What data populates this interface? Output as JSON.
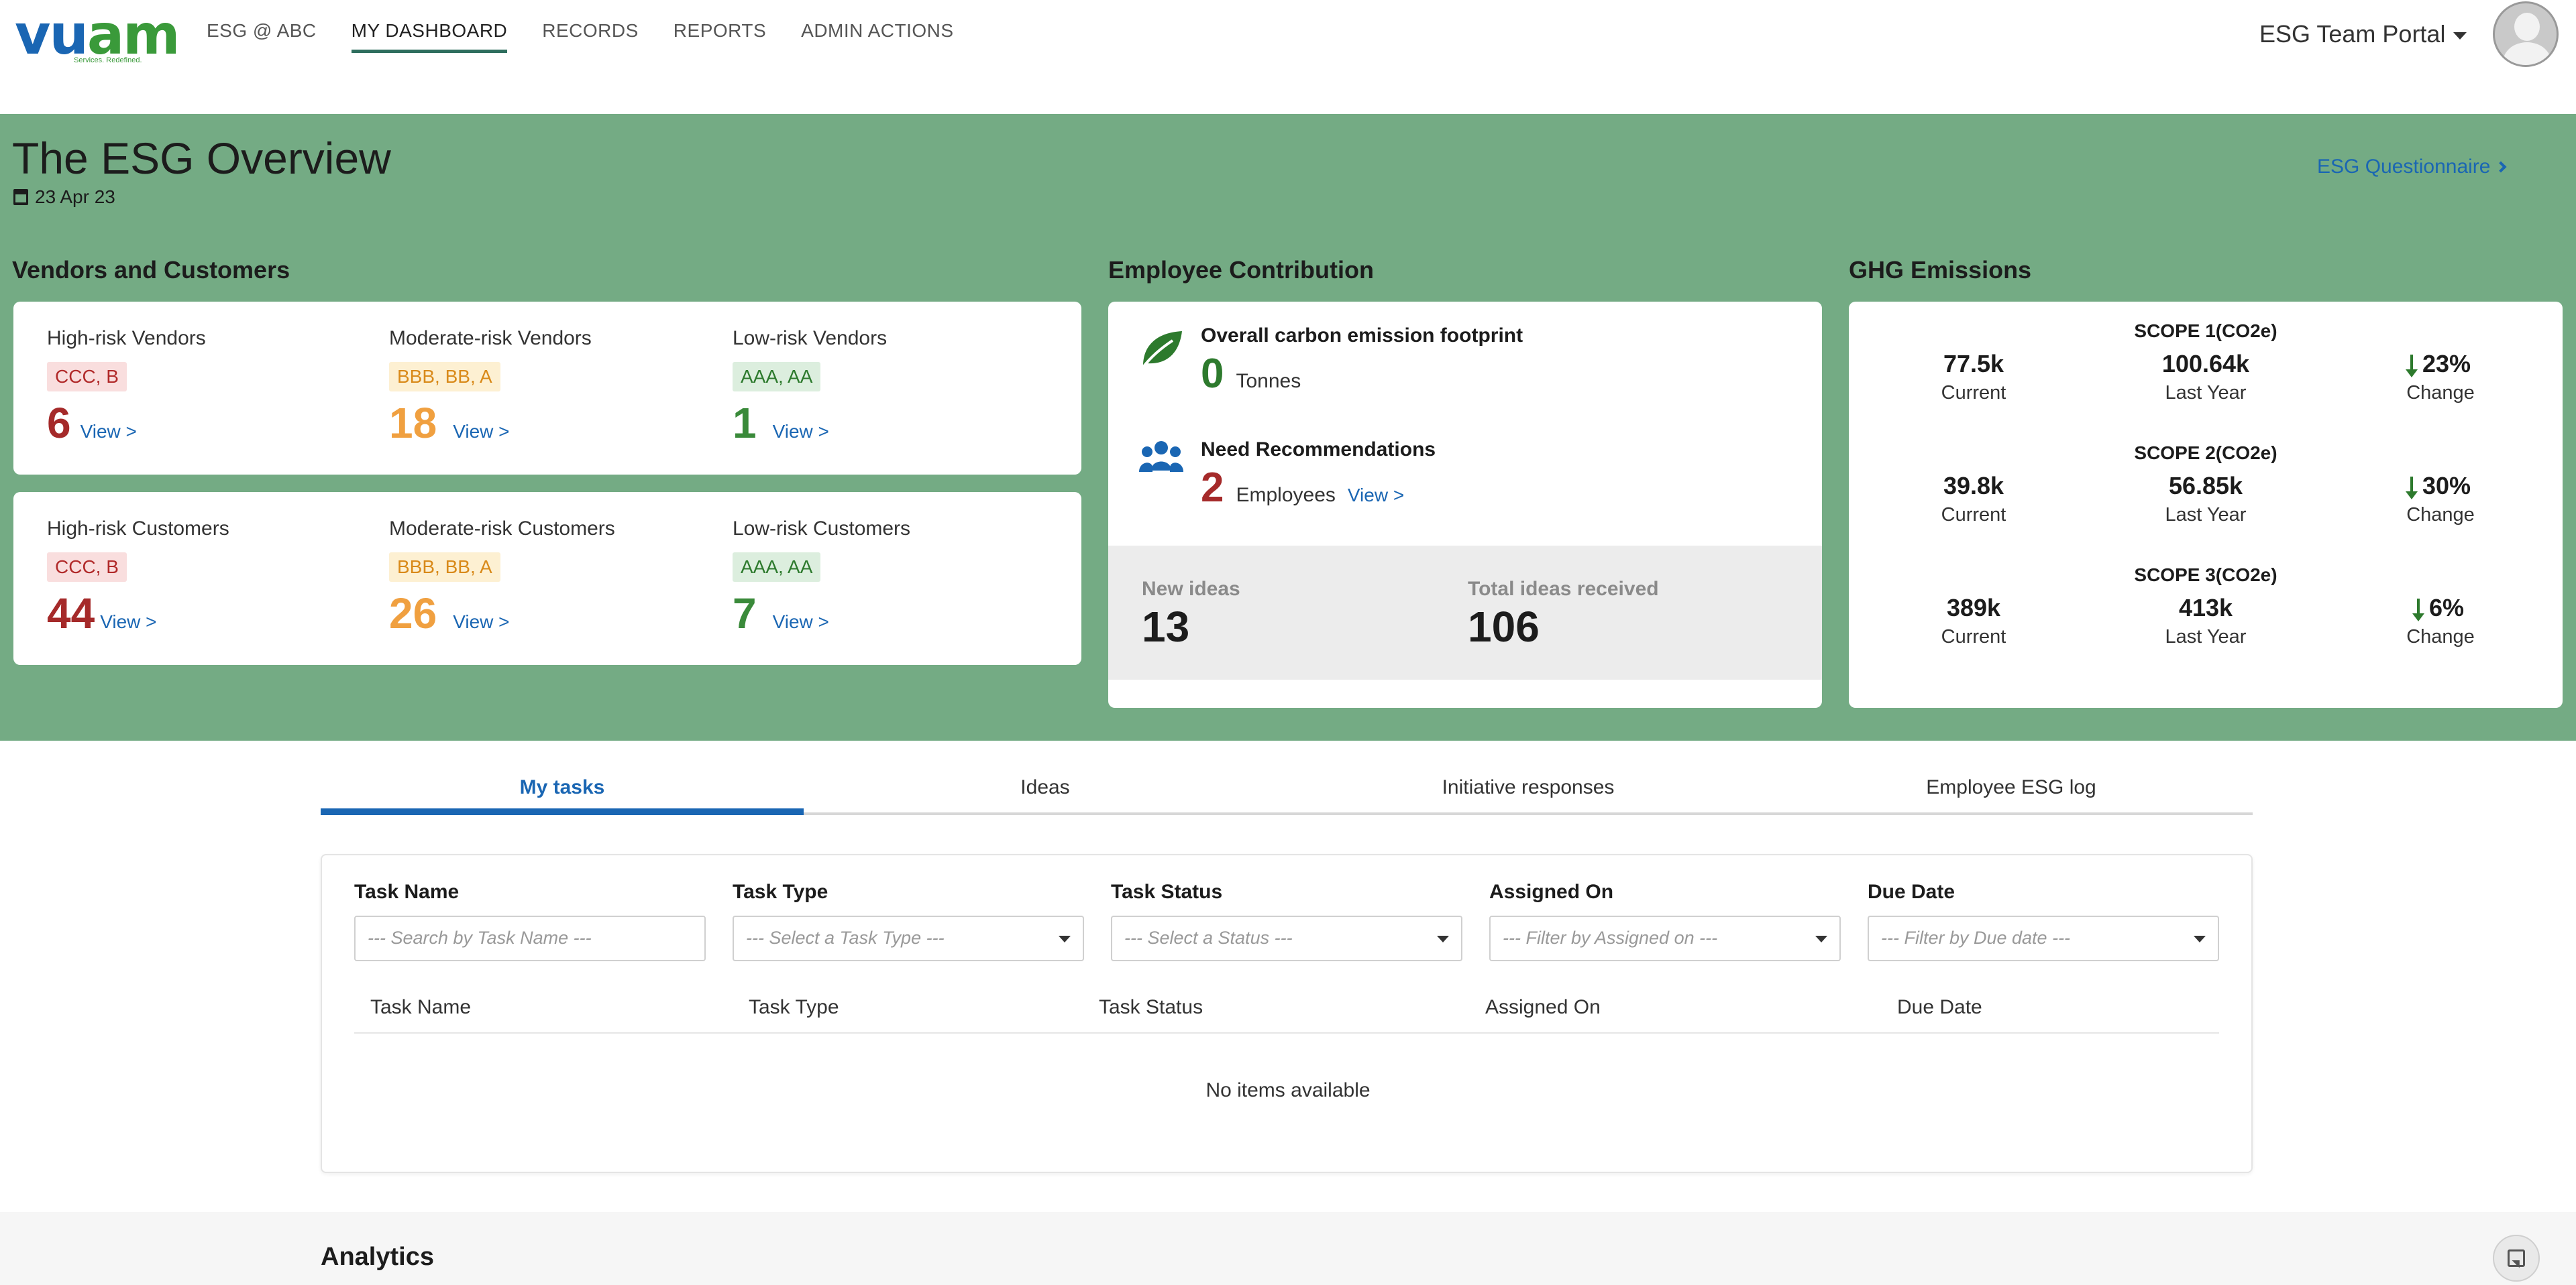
{
  "brand": {
    "logo_main": "vu",
    "logo_accent": "am",
    "logo_tagline": "Services. Redefined."
  },
  "nav": {
    "items": [
      {
        "label": "ESG @ ABC",
        "active": false
      },
      {
        "label": "MY DASHBOARD",
        "active": true
      },
      {
        "label": "RECORDS",
        "active": false
      },
      {
        "label": "REPORTS",
        "active": false
      },
      {
        "label": "ADMIN ACTIONS",
        "active": false
      }
    ],
    "portal": "ESG Team Portal"
  },
  "overview": {
    "title": "The ESG Overview",
    "date": "23 Apr 23",
    "questionnaire_link": "ESG Questionnaire",
    "vendors_customers": {
      "section_title": "Vendors and Customers",
      "vendors": [
        {
          "label": "High-risk Vendors",
          "badge": "CCC, B",
          "count": "6",
          "view": "View >"
        },
        {
          "label": "Moderate-risk Vendors",
          "badge": "BBB, BB, A",
          "count": "18",
          "view": "View >"
        },
        {
          "label": "Low-risk Vendors",
          "badge": "AAA, AA",
          "count": "1",
          "view": "View >"
        }
      ],
      "customers": [
        {
          "label": "High-risk Customers",
          "badge": "CCC, B",
          "count": "44",
          "view": "View >"
        },
        {
          "label": "Moderate-risk Customers",
          "badge": "BBB, BB, A",
          "count": "26",
          "view": "View >"
        },
        {
          "label": "Low-risk Customers",
          "badge": "AAA, AA",
          "count": "7",
          "view": "View >"
        }
      ]
    },
    "employee": {
      "section_title": "Employee Contribution",
      "carbon_title": "Overall carbon emission footprint",
      "carbon_value": "0",
      "carbon_unit": "Tonnes",
      "rec_title": "Need Recommendations",
      "rec_value": "2",
      "rec_unit": "Employees",
      "rec_view": "View >",
      "new_ideas_label": "New ideas",
      "new_ideas_value": "13",
      "total_ideas_label": "Total ideas received",
      "total_ideas_value": "106"
    },
    "ghg": {
      "section_title": "GHG Emissions",
      "scopes": [
        {
          "title": "SCOPE 1(CO2e)",
          "current": "77.5k",
          "last_year": "100.64k",
          "change": "23%"
        },
        {
          "title": "SCOPE 2(CO2e)",
          "current": "39.8k",
          "last_year": "56.85k",
          "change": "30%"
        },
        {
          "title": "SCOPE 3(CO2e)",
          "current": "389k",
          "last_year": "413k",
          "change": "6%"
        }
      ],
      "current_label": "Current",
      "last_year_label": "Last Year",
      "change_label": "Change"
    }
  },
  "tabs": [
    {
      "label": "My tasks",
      "active": true
    },
    {
      "label": "Ideas",
      "active": false
    },
    {
      "label": "Initiative responses",
      "active": false
    },
    {
      "label": "Employee ESG log",
      "active": false
    }
  ],
  "tasks": {
    "filters": [
      {
        "label": "Task Name",
        "placeholder": "--- Search by Task Name ---",
        "type": "text"
      },
      {
        "label": "Task Type",
        "placeholder": "--- Select a Task Type ---",
        "type": "select"
      },
      {
        "label": "Task Status",
        "placeholder": "--- Select a Status ---",
        "type": "select"
      },
      {
        "label": "Assigned On",
        "placeholder": "--- Filter by Assigned on ---",
        "type": "select"
      },
      {
        "label": "Due Date",
        "placeholder": "--- Filter by Due date ---",
        "type": "select"
      }
    ],
    "columns": [
      "Task Name",
      "Task Type",
      "Task Status",
      "Assigned On",
      "Due Date"
    ],
    "empty_message": "No items available"
  },
  "analytics": {
    "title": "Analytics"
  },
  "colors": {
    "band": "#74ab84",
    "link": "#1a66b3",
    "high": "#a52a2a",
    "moderate": "#f0a040",
    "low": "#3a8a3a"
  }
}
